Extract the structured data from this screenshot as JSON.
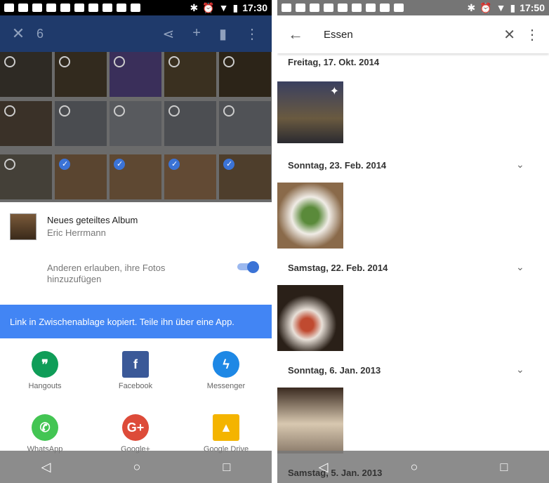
{
  "left": {
    "status": {
      "time": "17:30"
    },
    "appbar": {
      "close_icon": "close-icon",
      "selected_count": "6"
    },
    "album": {
      "title": "Neues geteiltes Album",
      "owner": "Eric Herrmann",
      "allow_label": "Anderen erlauben, ihre Fotos hinzuzufügen"
    },
    "snackbar": "Link in Zwischenablage kopiert. Teile ihn über eine App.",
    "apps": [
      {
        "label": "Hangouts",
        "color": "#0f9d58"
      },
      {
        "label": "Facebook",
        "color": "#3b5998"
      },
      {
        "label": "Messenger",
        "color": "#1e88e5"
      },
      {
        "label": "WhatsApp",
        "color": "#43c553"
      },
      {
        "label": "Google+",
        "color": "#dd4b39"
      },
      {
        "label": "Google Drive",
        "color": "#f4b400"
      }
    ]
  },
  "right": {
    "status": {
      "time": "17:50"
    },
    "search": {
      "query": "Essen"
    },
    "groups": [
      {
        "date": "Freitag, 17. Okt. 2014"
      },
      {
        "date": "Sonntag, 23. Feb. 2014"
      },
      {
        "date": "Samstag, 22. Feb. 2014"
      },
      {
        "date": "Sonntag, 6. Jan. 2013"
      },
      {
        "date": "Samstag, 5. Jan. 2013"
      }
    ]
  }
}
